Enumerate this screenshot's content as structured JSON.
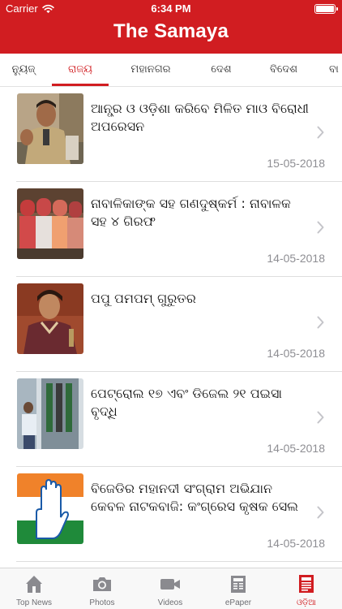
{
  "status_bar": {
    "carrier": "Carrier",
    "time": "6:34 PM"
  },
  "header": {
    "title": "The Samaya"
  },
  "tabs": [
    {
      "label": "ନ୍ୟୁଜ୍"
    },
    {
      "label": "ରାଜ୍ୟ"
    },
    {
      "label": "ମହାନଗର"
    },
    {
      "label": "ଦେଶ"
    },
    {
      "label": "ବିଦେଶ"
    },
    {
      "label": "ବା"
    }
  ],
  "active_tab": 1,
  "news": [
    {
      "title": "ଆନ୍ଧ୍ର ଓ ଓଡ଼ିଶା କରିବେ ମିଳିତ ମାଓ ବିରୋଧୀ ଅପରେସନ",
      "date": "15-05-2018",
      "thumb": "police-officer-photo"
    },
    {
      "title": "ନାବାଳିକାଙ୍କ ସହ ଗଣଦୁଷ୍କର୍ମ : ନାବାଳକ ସହ ୪ ଗିରଫ",
      "date": "14-05-2018",
      "thumb": "arrested-youths-photo"
    },
    {
      "title": "ପପୁ ପମପମ୍ ଗୁରୁତର",
      "date": "14-05-2018",
      "thumb": "actor-portrait-photo"
    },
    {
      "title": "ପେଟ୍ରୋଲ ୧୭ ଏବଂ ଡିଜେଲ ୨୧ ପଇସା ବୃଦ୍ଧି",
      "date": "14-05-2018",
      "thumb": "fuel-pump-photo"
    },
    {
      "title": "ବିଜେଡିର ମହାନଦୀ ସଂଗ୍ରାମ ଅଭିଯାନ କେବଳ ନାଟକବାଜି: କଂଗ୍ରେସ କୃଷକ ସେଲ",
      "date": "14-05-2018",
      "thumb": "congress-hand-logo"
    }
  ],
  "bottom_nav": [
    {
      "label": "Top News",
      "icon": "home-icon"
    },
    {
      "label": "Photos",
      "icon": "camera-icon"
    },
    {
      "label": "Videos",
      "icon": "video-icon"
    },
    {
      "label": "ePaper",
      "icon": "newspaper-icon"
    },
    {
      "label": "ଓଡ଼ିଆ",
      "icon": "odia-paper-icon"
    }
  ],
  "active_nav": 4,
  "colors": {
    "brand": "#d11d21",
    "date_gray": "#8e8e93",
    "nav_gray": "#8a8a8f"
  }
}
